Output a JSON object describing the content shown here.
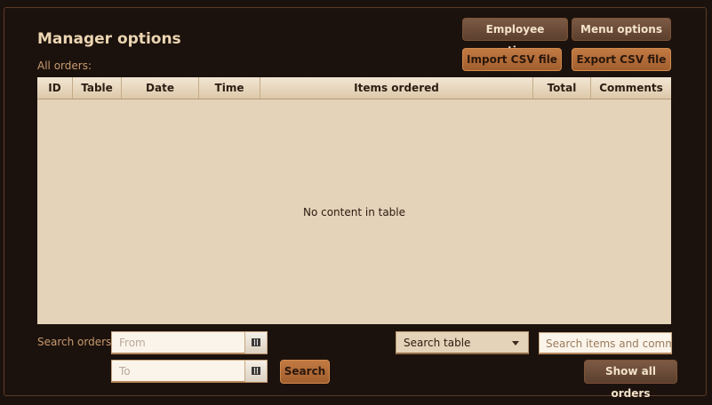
{
  "header": {
    "title": "Manager options",
    "subtitle": "All orders:"
  },
  "toolbar": {
    "employee_options": "Employee options",
    "menu_options": "Menu options",
    "import_csv": "Import CSV file",
    "export_csv": "Export CSV file"
  },
  "table": {
    "columns": [
      "ID",
      "Table",
      "Date",
      "Time",
      "Items ordered",
      "Total",
      "Comments"
    ],
    "empty_message": "No content in table"
  },
  "search": {
    "label": "Search orders:",
    "from_placeholder": "From",
    "to_placeholder": "To",
    "search_button": "Search",
    "select_value": "Search table",
    "query_placeholder": "Search items and comments",
    "show_all": "Show all orders"
  },
  "colors": {
    "background": "#1c120d",
    "table_bg": "#e4d3b8",
    "accent": "#b86f3a",
    "text_light": "#ecd5b2"
  }
}
